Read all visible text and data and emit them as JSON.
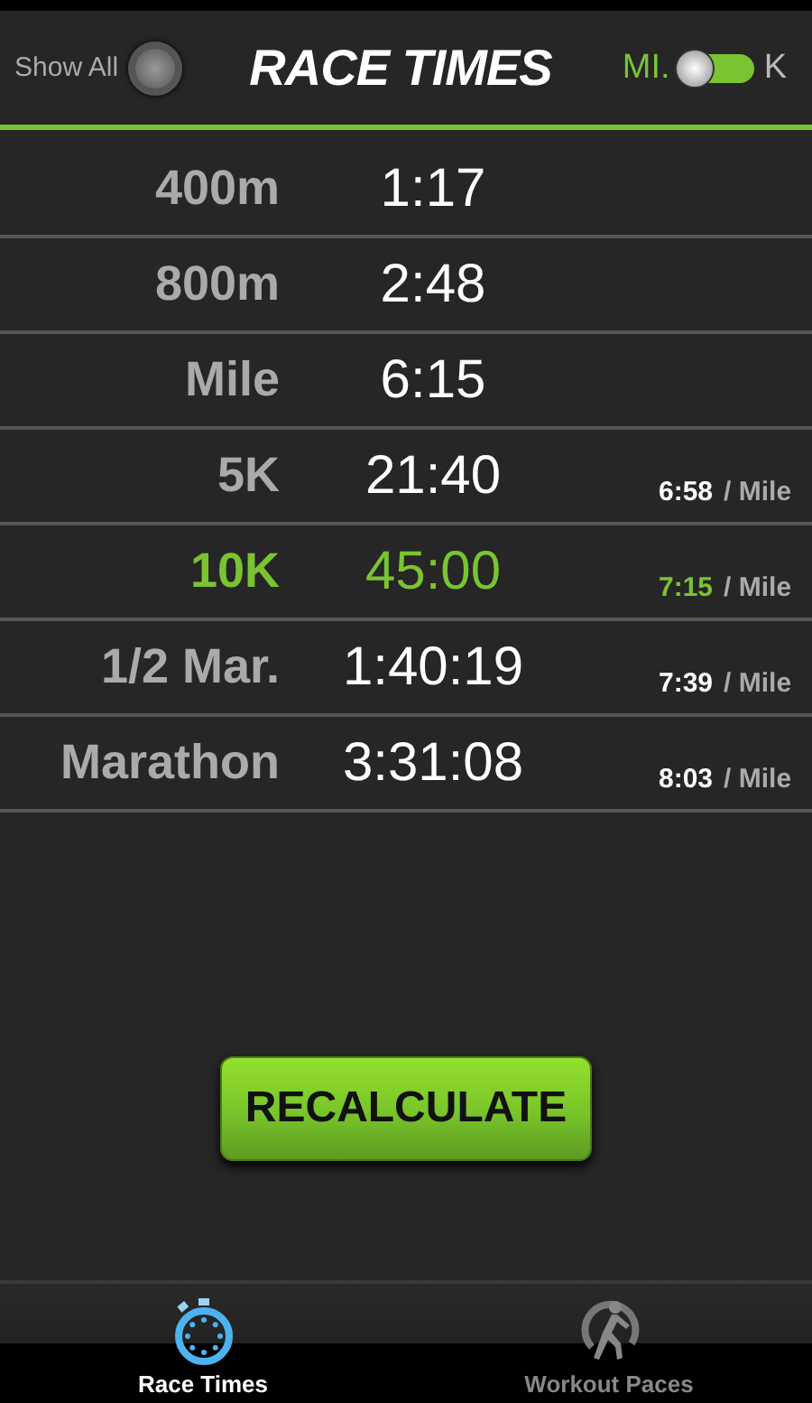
{
  "header": {
    "show_all": {
      "label": "Show All",
      "on": false
    },
    "title": "RACE TIMES",
    "units": {
      "options": [
        {
          "label": "MI.",
          "selected": true
        },
        {
          "label": "K",
          "selected": false
        }
      ],
      "on": false
    }
  },
  "races": [
    {
      "distance": "400m",
      "time": "1:17",
      "selected": false
    },
    {
      "distance": "800m",
      "time": "2:48",
      "selected": false
    },
    {
      "distance": "Mile",
      "time": "6:15",
      "selected": false
    },
    {
      "distance": "5K",
      "time": "21:40",
      "pace": "6:58",
      "pace_unit": "/ Mile",
      "selected": false
    },
    {
      "distance": "10K",
      "time": "45:00",
      "pace": "7:15",
      "pace_unit": "/ Mile",
      "selected": true
    },
    {
      "distance": "1/2 Mar.",
      "time": "1:40:19",
      "pace": "7:39",
      "pace_unit": "/ Mile",
      "selected": false
    },
    {
      "distance": "Marathon",
      "time": "3:31:08",
      "pace": "8:03",
      "pace_unit": "/ Mile",
      "selected": false
    }
  ],
  "button": "RECALCULATE",
  "tabs": [
    {
      "label": "Race Times",
      "kind": "stopwatch",
      "selected": true
    },
    {
      "label": "Workout Paces",
      "kind": "runner",
      "selected": false
    }
  ]
}
